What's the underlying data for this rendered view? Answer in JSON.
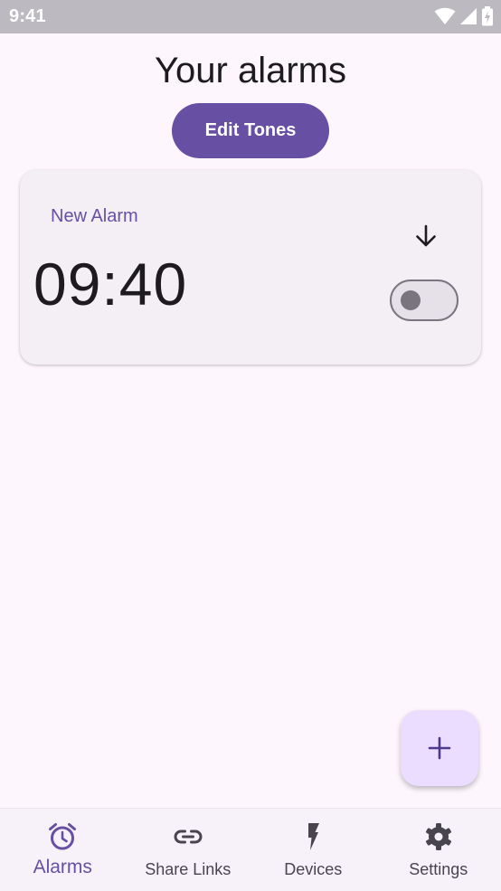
{
  "status_bar": {
    "time": "9:41",
    "icons": [
      "wifi-icon",
      "cellular-signal-icon",
      "battery-charging-icon"
    ]
  },
  "header": {
    "title": "Your alarms",
    "edit_tones_label": "Edit Tones"
  },
  "alarms": [
    {
      "name": "New Alarm",
      "time": "09:40",
      "enabled": false,
      "expand_icon": "arrow-down-icon"
    }
  ],
  "fab": {
    "icon": "plus-icon"
  },
  "bottom_nav": {
    "selected": "Alarms",
    "items": [
      {
        "label": "Alarms",
        "icon": "alarm-clock-icon"
      },
      {
        "label": "Share Links",
        "icon": "link-icon"
      },
      {
        "label": "Devices",
        "icon": "bolt-icon"
      },
      {
        "label": "Settings",
        "icon": "gear-icon"
      }
    ]
  },
  "colors": {
    "primary": "#6750a4",
    "background": "#fdf7fd",
    "card": "#f3eff4",
    "fab": "#eaddff",
    "status_bar": "#bcbac0"
  }
}
